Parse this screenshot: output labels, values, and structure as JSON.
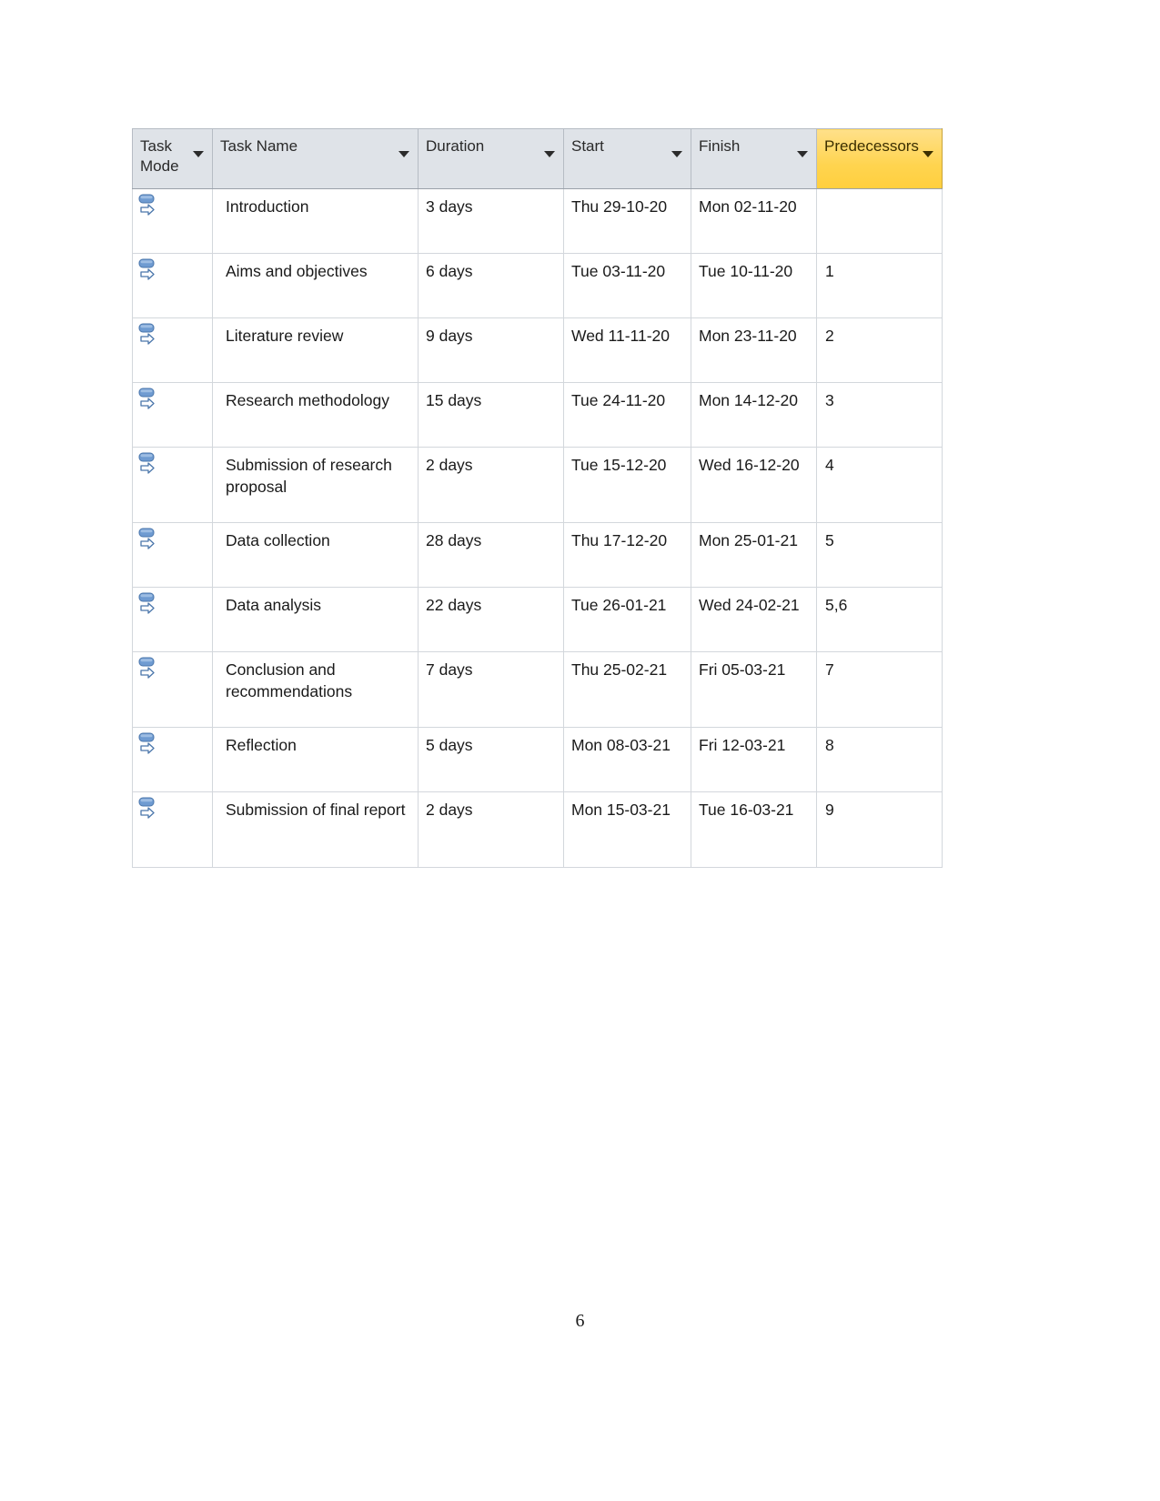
{
  "document": {
    "page_number": "6"
  },
  "table": {
    "columns": [
      {
        "id": "task_mode",
        "label": "Task\nMode",
        "has_filter": true,
        "highlighted": false
      },
      {
        "id": "task_name",
        "label": "Task Name",
        "has_filter": true,
        "highlighted": false
      },
      {
        "id": "duration",
        "label": "Duration",
        "has_filter": true,
        "highlighted": false
      },
      {
        "id": "start",
        "label": "Start",
        "has_filter": true,
        "highlighted": false
      },
      {
        "id": "finish",
        "label": "Finish",
        "has_filter": true,
        "highlighted": false
      },
      {
        "id": "predecessors",
        "label": "Predecessors",
        "has_filter": true,
        "highlighted": true
      }
    ],
    "highlight_color": "#ffd966",
    "header_background": "#dfe3e8",
    "task_mode_icon": "manually-scheduled-icon",
    "rows": [
      {
        "task_mode": "manually-scheduled-icon",
        "task_name": "Introduction",
        "duration": "3 days",
        "start": "Thu 29-10-20",
        "finish": "Mon 02-11-20",
        "predecessors": ""
      },
      {
        "task_mode": "manually-scheduled-icon",
        "task_name": "Aims and objectives",
        "duration": "6 days",
        "start": "Tue 03-11-20",
        "finish": "Tue 10-11-20",
        "predecessors": "1"
      },
      {
        "task_mode": "manually-scheduled-icon",
        "task_name": "Literature review",
        "duration": "9 days",
        "start": "Wed 11-11-20",
        "finish": "Mon 23-11-20",
        "predecessors": "2"
      },
      {
        "task_mode": "manually-scheduled-icon",
        "task_name": "Research methodology",
        "duration": "15 days",
        "start": "Tue 24-11-20",
        "finish": "Mon 14-12-20",
        "predecessors": "3"
      },
      {
        "task_mode": "manually-scheduled-icon",
        "task_name": "Submission of research proposal",
        "duration": "2 days",
        "start": "Tue 15-12-20",
        "finish": "Wed 16-12-20",
        "predecessors": "4"
      },
      {
        "task_mode": "manually-scheduled-icon",
        "task_name": "Data collection",
        "duration": "28 days",
        "start": "Thu 17-12-20",
        "finish": "Mon 25-01-21",
        "predecessors": "5"
      },
      {
        "task_mode": "manually-scheduled-icon",
        "task_name": "Data analysis",
        "duration": "22 days",
        "start": "Tue 26-01-21",
        "finish": "Wed 24-02-21",
        "predecessors": "5,6"
      },
      {
        "task_mode": "manually-scheduled-icon",
        "task_name": "Conclusion and recommendations",
        "duration": "7 days",
        "start": "Thu 25-02-21",
        "finish": "Fri 05-03-21",
        "predecessors": "7"
      },
      {
        "task_mode": "manually-scheduled-icon",
        "task_name": "Reflection",
        "duration": "5 days",
        "start": "Mon 08-03-21",
        "finish": "Fri 12-03-21",
        "predecessors": "8"
      },
      {
        "task_mode": "manually-scheduled-icon",
        "task_name": "Submission of final report",
        "duration": "2 days",
        "start": "Mon 15-03-21",
        "finish": "Tue 16-03-21",
        "predecessors": "9"
      }
    ]
  }
}
